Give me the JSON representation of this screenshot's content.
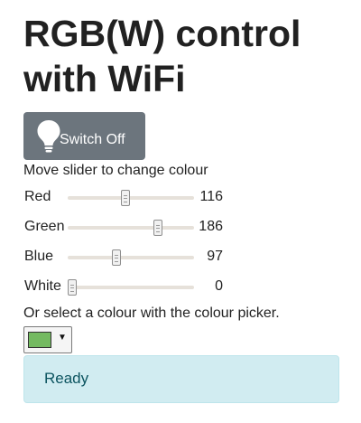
{
  "page": {
    "title": "RGB(W) control with WiFi"
  },
  "switch_button": {
    "label": "Switch Off",
    "icon": "lightbulb-icon"
  },
  "hint": "Move slider to change colour",
  "sliders": [
    {
      "label": "Red",
      "value": 116,
      "min": 0,
      "max": 255
    },
    {
      "label": "Green",
      "value": 186,
      "min": 0,
      "max": 255
    },
    {
      "label": "Blue",
      "value": 97,
      "min": 0,
      "max": 255
    },
    {
      "label": "White",
      "value": 0,
      "min": 0,
      "max": 255
    }
  ],
  "picker": {
    "text": "Or select a colour with the colour picker.",
    "selected_color": "#74ba61",
    "arrow": "▼"
  },
  "status": {
    "text": "Ready"
  },
  "colors": {
    "button_bg": "#6c757d",
    "status_bg": "#d1ecf1",
    "status_text": "#0c5460"
  }
}
